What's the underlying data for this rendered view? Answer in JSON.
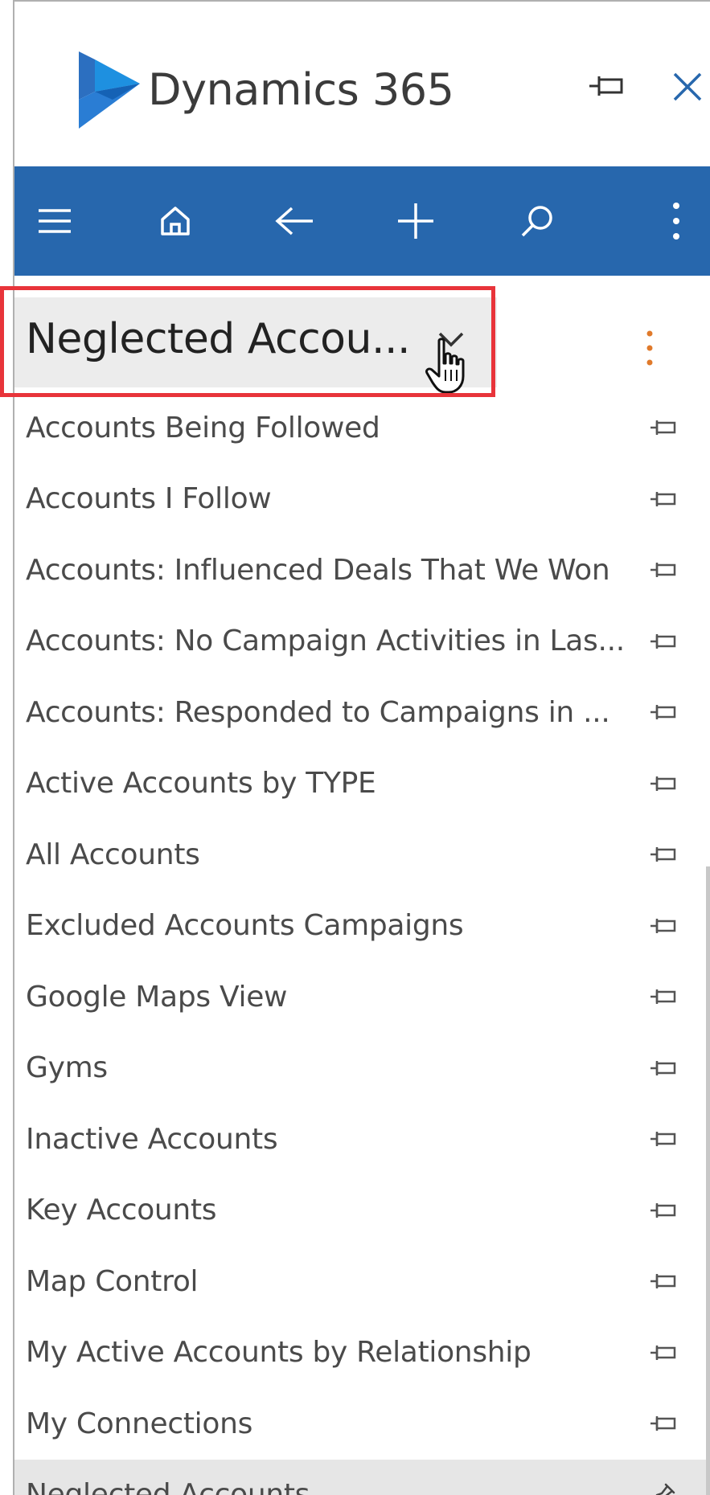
{
  "header": {
    "app_title": "Dynamics 365",
    "logo_icon": "dynamics-365-logo",
    "pin_icon": "pin-icon",
    "close_icon": "close-icon"
  },
  "toolbar": {
    "color": "#2767ad",
    "buttons": [
      {
        "name": "menu-button",
        "icon": "hamburger-icon"
      },
      {
        "name": "home-button",
        "icon": "home-icon"
      },
      {
        "name": "back-button",
        "icon": "back-arrow-icon"
      },
      {
        "name": "new-button",
        "icon": "plus-icon"
      },
      {
        "name": "search-button",
        "icon": "search-icon"
      },
      {
        "name": "more-button",
        "icon": "more-vertical-icon"
      }
    ]
  },
  "view_selector": {
    "title": "Neglected Accou...",
    "highlight_color": "#e8343a"
  },
  "views": [
    {
      "label": "Accounts Being Followed",
      "pinned": false,
      "selected": false
    },
    {
      "label": "Accounts I Follow",
      "pinned": false,
      "selected": false
    },
    {
      "label": "Accounts: Influenced Deals That We Won",
      "pinned": false,
      "selected": false
    },
    {
      "label": "Accounts: No Campaign Activities in Las...",
      "pinned": false,
      "selected": false
    },
    {
      "label": "Accounts: Responded to Campaigns in ...",
      "pinned": false,
      "selected": false
    },
    {
      "label": "Active Accounts by TYPE",
      "pinned": false,
      "selected": false
    },
    {
      "label": "All Accounts",
      "pinned": false,
      "selected": false
    },
    {
      "label": "Excluded Accounts Campaigns",
      "pinned": false,
      "selected": false
    },
    {
      "label": "Google Maps View",
      "pinned": false,
      "selected": false
    },
    {
      "label": "Gyms",
      "pinned": false,
      "selected": false
    },
    {
      "label": "Inactive Accounts",
      "pinned": false,
      "selected": false
    },
    {
      "label": "Key Accounts",
      "pinned": false,
      "selected": false
    },
    {
      "label": "Map Control",
      "pinned": false,
      "selected": false
    },
    {
      "label": "My Active Accounts by Relationship",
      "pinned": false,
      "selected": false
    },
    {
      "label": "My Connections",
      "pinned": false,
      "selected": false
    },
    {
      "label": "Neglected Accounts",
      "pinned": true,
      "selected": true
    }
  ]
}
